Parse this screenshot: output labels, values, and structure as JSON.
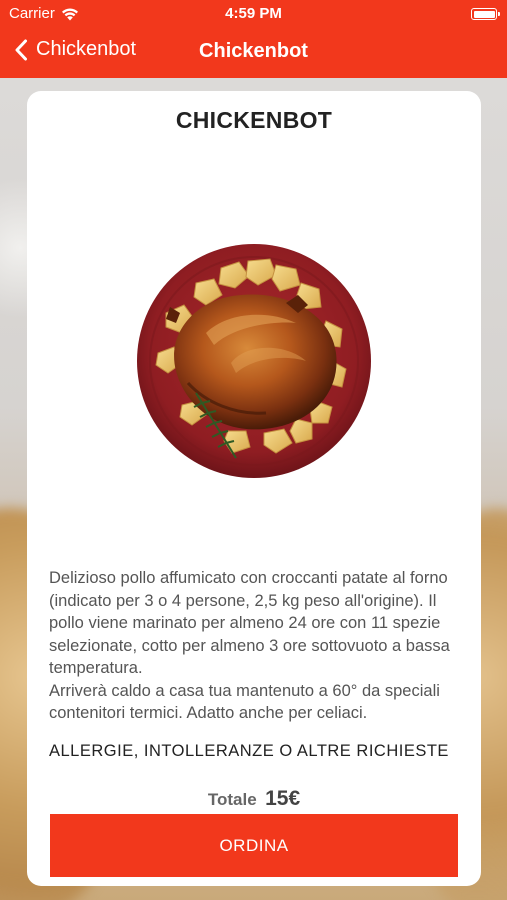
{
  "status_bar": {
    "carrier": "Carrier",
    "time": "4:59 PM"
  },
  "nav": {
    "back_label": "Chickenbot",
    "title": "Chickenbot"
  },
  "product": {
    "title": "CHICKENBOT",
    "description": "Delizioso pollo affumicato con croccanti patate al forno (indicato per 3 o 4 persone, 2,5 kg peso all'origine). Il pollo viene marinato per almeno 24 ore con 11 spezie selezionate, cotto per almeno 3 ore sottovuoto a bassa temperatura.\nArriverà caldo a casa tua mantenuto a 60° da speciali contenitori termici. Adatto anche per celiaci.",
    "allergy_heading": "ALLERGIE, INTOLLERANZE O ALTRE RICHIESTE"
  },
  "order": {
    "total_label": "Totale",
    "total_value": "15€",
    "order_button": "ORDINA"
  },
  "colors": {
    "accent": "#f2381c",
    "plate": "#8f1d22"
  },
  "icons": {
    "back": "chevron-left-icon",
    "wifi": "wifi-icon",
    "battery": "battery-icon"
  }
}
